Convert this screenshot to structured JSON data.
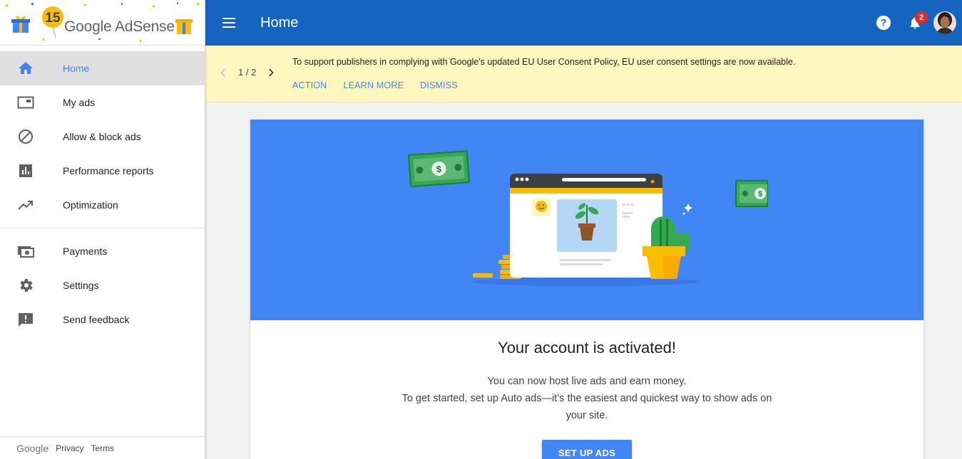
{
  "brand": {
    "logo_text": "Google AdSense",
    "anniversary": "15"
  },
  "header": {
    "title": "Home",
    "notifications_count": "2",
    "icons": [
      "menu-icon",
      "help-icon",
      "bell-icon"
    ],
    "bar_color": "#1565c0"
  },
  "sidebar": {
    "items": [
      {
        "label": "Home",
        "icon": "home-icon",
        "active": true
      },
      {
        "label": "My ads",
        "icon": "ad-unit-icon"
      },
      {
        "label": "Allow & block ads",
        "icon": "block-icon"
      },
      {
        "label": "Performance reports",
        "icon": "bar-chart-icon"
      },
      {
        "label": "Optimization",
        "icon": "trending-up-icon"
      }
    ],
    "items2": [
      {
        "label": "Payments",
        "icon": "payments-icon"
      },
      {
        "label": "Settings",
        "icon": "gear-icon"
      },
      {
        "label": "Send feedback",
        "icon": "feedback-icon"
      }
    ],
    "footer": {
      "google": "Google",
      "privacy": "Privacy",
      "terms": "Terms"
    }
  },
  "notice": {
    "page": "1 / 2",
    "text": "To support publishers in complying with Google's updated EU User Consent Policy, EU user consent settings are now available.",
    "actions": {
      "action": "ACTION",
      "learn_more": "LEARN MORE",
      "dismiss": "DISMISS"
    },
    "bg_color": "#fef7c0"
  },
  "card": {
    "title": "Your account is activated!",
    "line1": "You can now host live ads and earn money.",
    "line2": "To get started, set up Auto ads—it’s the easiest and quickest way to show ads on your site.",
    "cta": "SET UP ADS",
    "hero_color": "#4285f4"
  }
}
